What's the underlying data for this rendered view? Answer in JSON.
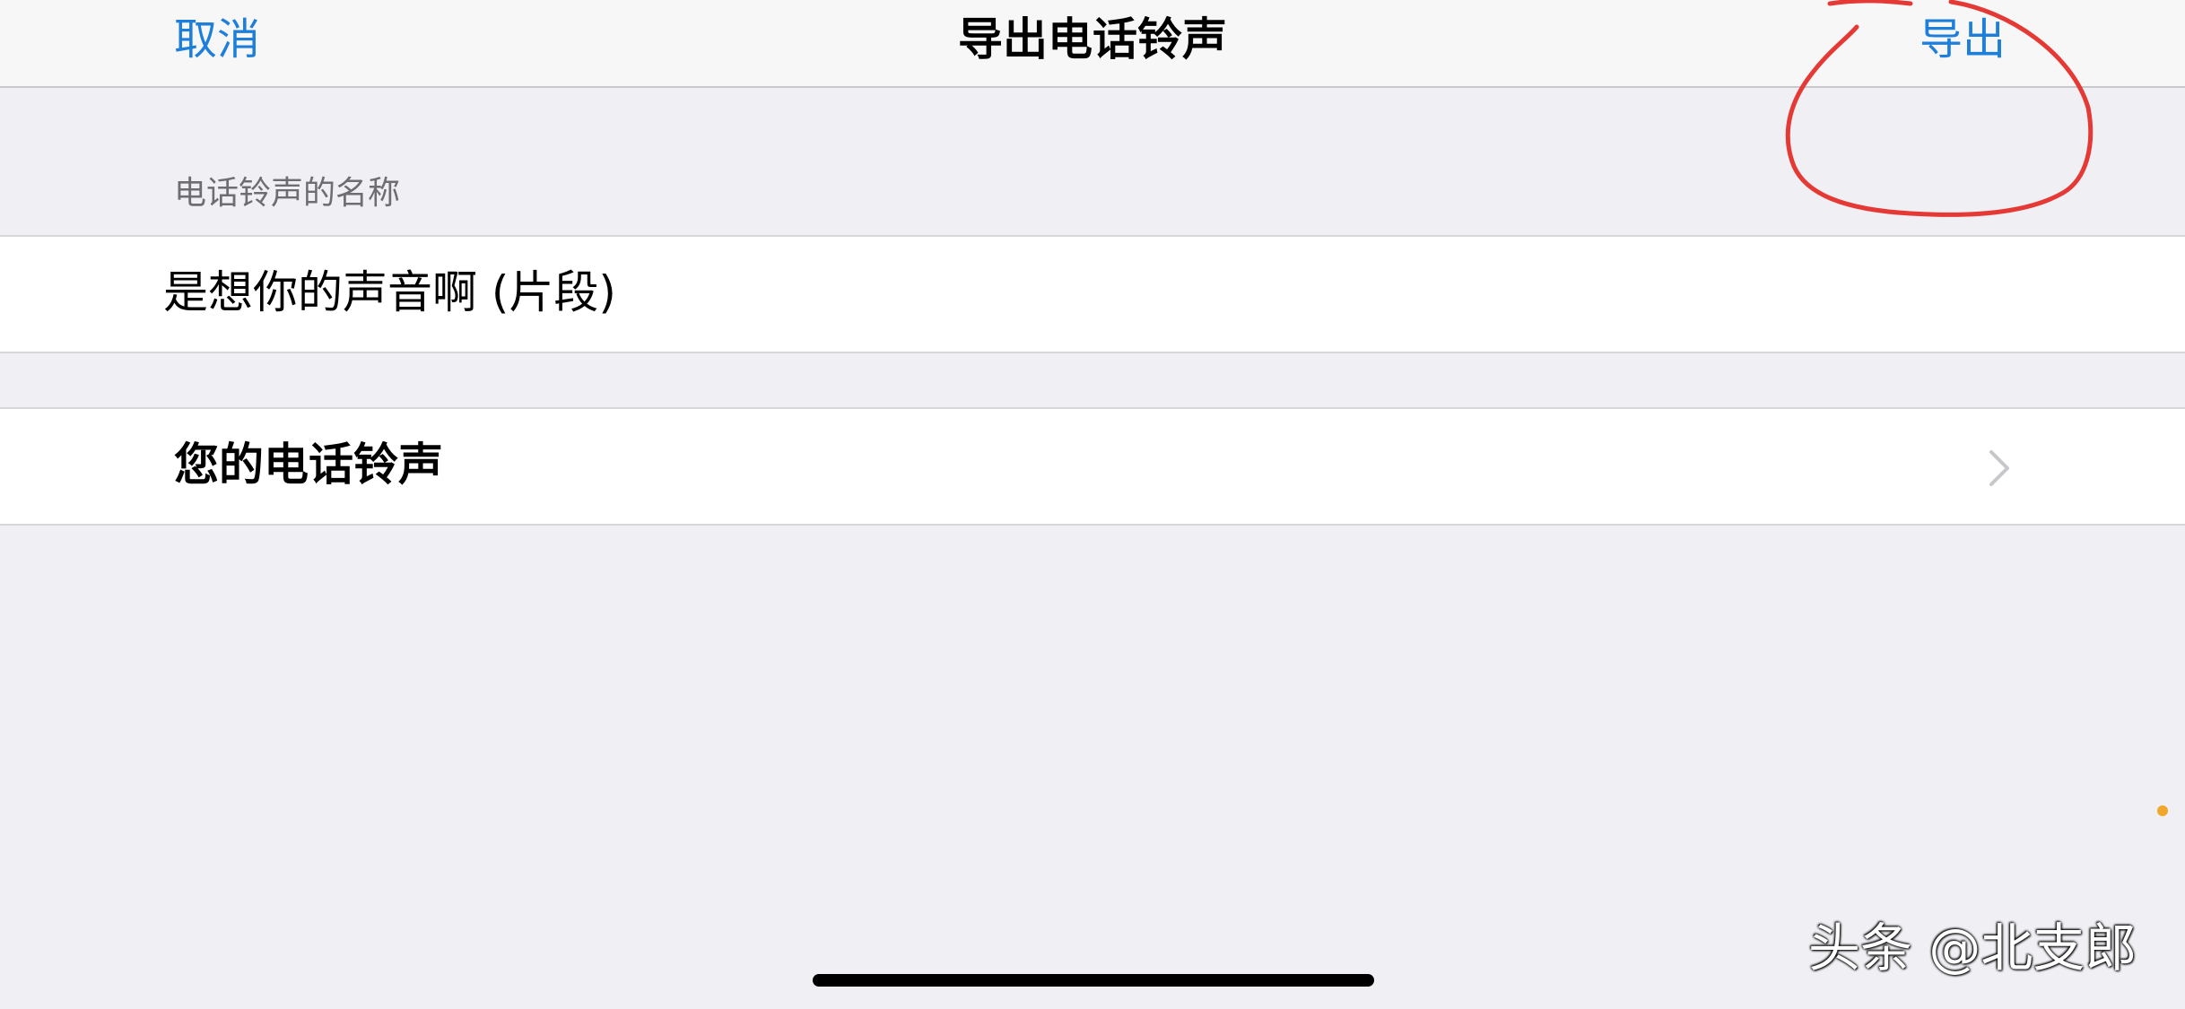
{
  "nav": {
    "cancel_label": "取消",
    "title": "导出电话铃声",
    "export_label": "导出"
  },
  "ringtone_name": {
    "section_header": "电话铃声的名称",
    "value": "是想你的声音啊 (片段)"
  },
  "your_ringtones": {
    "label": "您的电话铃声"
  },
  "watermark": "头条 @北支郎",
  "colors": {
    "accent": "#1d7fd9",
    "background": "#efeff4",
    "annotation": "#e53935",
    "indicator_dot": "#f2a72b"
  },
  "icons": [
    "chevron-right-icon"
  ]
}
